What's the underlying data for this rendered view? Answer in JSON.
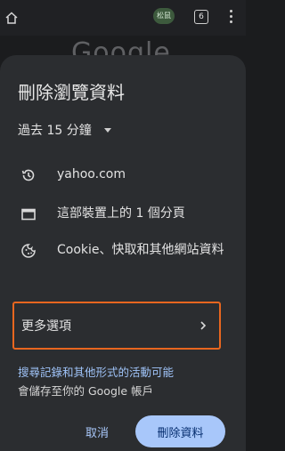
{
  "background": {
    "avatar_text": "松鼠",
    "tab_count": "6",
    "logo_text": "Google"
  },
  "sheet": {
    "title": "刪除瀏覽資料",
    "time_range": "過去 15 分鐘",
    "items": [
      {
        "icon": "history-icon",
        "label": "yahoo.com"
      },
      {
        "icon": "tab-icon",
        "label": "這部裝置上的 1 個分頁"
      },
      {
        "icon": "cookie-icon",
        "label": "Cookie、快取和其他網站資料"
      }
    ],
    "more_options_label": "更多選項",
    "info_link_text": "搜尋記錄和其他形式的活動可能",
    "info_suffix_text": "會儲存至你的 Google 帳戶",
    "cancel_label": "取消",
    "delete_label": "刪除資料",
    "colors": {
      "accent": "#a8c7fa",
      "highlight_border": "#e8661f",
      "sheet_bg": "#2b2d30"
    }
  }
}
